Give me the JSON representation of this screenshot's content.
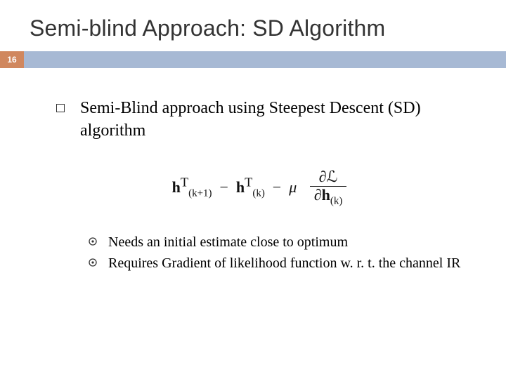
{
  "slide": {
    "title": "Semi-blind Approach: SD Algorithm",
    "pageNumber": "16",
    "mainBullet": "Semi-Blind approach using Steepest Descent (SD) algorithm",
    "formula": {
      "lhs_base": "h",
      "lhs_sup": "T",
      "lhs_sub": "(k+1)",
      "mid_base": "h",
      "mid_sup": "T",
      "mid_sub": "(k)",
      "mu": "μ",
      "partial": "∂",
      "L": "ℒ",
      "den_base": "h",
      "den_sub": "(k)"
    },
    "subBullets": [
      "Needs an initial estimate close to optimum",
      "Requires Gradient of likelihood function w. r. t. the channel IR"
    ]
  }
}
